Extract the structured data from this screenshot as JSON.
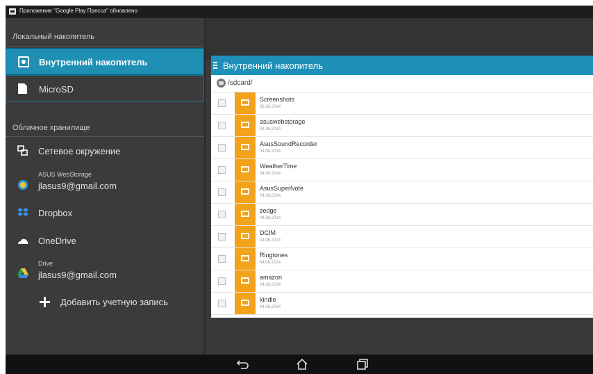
{
  "status_bar": {
    "notification": "Приложение \"Google Play Прессa\" обновлено",
    "notification_icon": "image-notification-icon"
  },
  "drawer": {
    "local_section": "Локальный накопитель",
    "local_items": [
      {
        "label": "Внутренний накопитель",
        "icon": "phone-storage-icon",
        "selected": true
      },
      {
        "label": "MicroSD",
        "icon": "sd-card-icon",
        "selected": false
      }
    ],
    "cloud_section": "Облачное хранилище",
    "cloud_items": [
      {
        "label": "Сетевое окружение",
        "icon": "network-icon"
      },
      {
        "label": "ASUS WebStorage",
        "account": "jlasus9@gmail.com",
        "icon": "asus-webstorage-icon"
      },
      {
        "label": "Dropbox",
        "icon": "dropbox-icon"
      },
      {
        "label": "OneDrive",
        "icon": "onedrive-icon"
      },
      {
        "label": "Drive",
        "account": "jlasus9@gmail.com",
        "icon": "google-drive-icon"
      }
    ],
    "add_account": "Добавить учетную запись"
  },
  "panel": {
    "title": "Внутренний накопитель",
    "path": "/sdcard/",
    "files": [
      {
        "name": "Screenshots",
        "date": "06.06.2014"
      },
      {
        "name": "asuswebstorage",
        "date": "04.06.2014"
      },
      {
        "name": "AsusSoundRecorder",
        "date": "04.06.2014"
      },
      {
        "name": "WeatherTime",
        "date": "04.06.2014"
      },
      {
        "name": "AsusSuperNote",
        "date": "04.06.2014"
      },
      {
        "name": "zedge",
        "date": "04.06.2014"
      },
      {
        "name": "DCIM",
        "date": "04.06.2014"
      },
      {
        "name": "Ringtones",
        "date": "04.06.2014"
      },
      {
        "name": "amazon",
        "date": "04.06.2014"
      },
      {
        "name": "kindle",
        "date": "04.06.2014"
      }
    ]
  },
  "colors": {
    "accent": "#1e90b8",
    "folder": "#f2a21b",
    "drawer_bg": "#3b3b3b"
  }
}
